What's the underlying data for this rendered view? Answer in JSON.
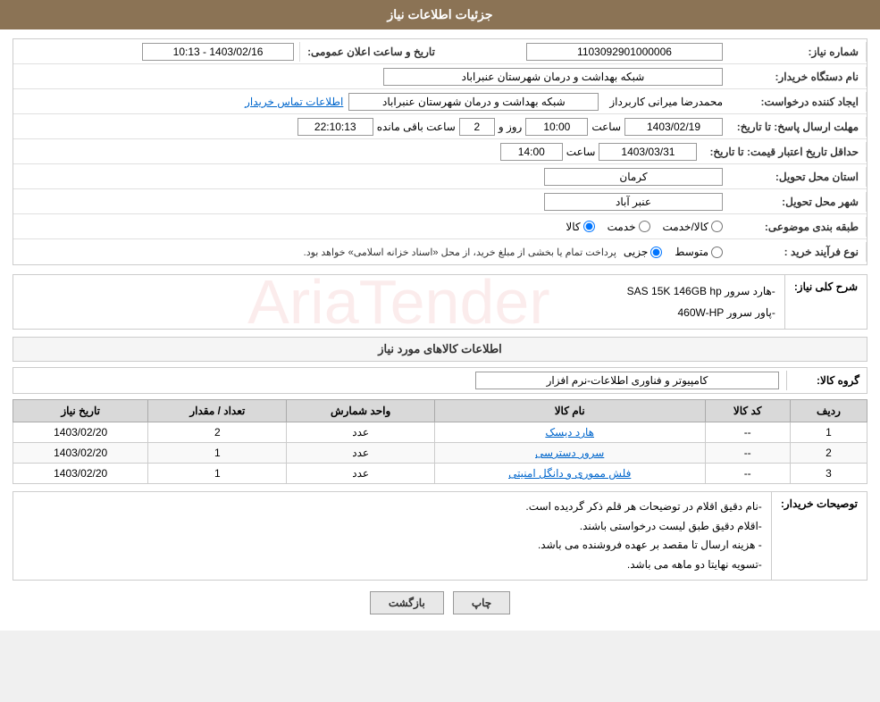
{
  "header": {
    "title": "جزئیات اطلاعات نیاز"
  },
  "fields": {
    "need_number_label": "شماره نیاز:",
    "need_number_value": "1103092901000006",
    "buyer_org_label": "نام دستگاه خریدار:",
    "buyer_org_value": "شبکه بهداشت و درمان شهرستان عنبراباد",
    "requester_label": "ایجاد کننده درخواست:",
    "requester_name": "محمدرضا میرانی کاربرداز",
    "requester_org": "شبکه بهداشت و درمان شهرستان عنبراباد",
    "contact_link": "اطلاعات تماس خریدار",
    "send_deadline_label": "مهلت ارسال پاسخ: تا تاریخ:",
    "send_date": "1403/02/19",
    "send_time_label": "ساعت",
    "send_time": "10:00",
    "send_days_label": "روز و",
    "send_days": "2",
    "send_remaining_label": "ساعت باقی مانده",
    "send_remaining": "22:10:13",
    "price_deadline_label": "حداقل تاریخ اعتبار قیمت: تا تاریخ:",
    "price_date": "1403/03/31",
    "price_time_label": "ساعت",
    "price_time": "14:00",
    "province_label": "استان محل تحویل:",
    "province_value": "کرمان",
    "city_label": "شهر محل تحویل:",
    "city_value": "عنبر آباد",
    "category_label": "طبقه بندی موضوعی:",
    "category_kala": "کالا",
    "category_khadamat": "خدمت",
    "category_kala_khadamat": "کالا/خدمت",
    "purchase_type_label": "نوع فرآیند خرید :",
    "purchase_jozei": "جزیی",
    "purchase_motavasset": "متوسط",
    "purchase_note": "پرداخت تمام یا بخشی از مبلغ خرید، از محل «اسناد خزانه اسلامی» خواهد بود.",
    "announce_label": "تاریخ و ساعت اعلان عمومی:",
    "announce_value": "1403/02/16 - 10:13",
    "description_label": "شرح کلی نیاز:",
    "description_line1": "-هارد سرور SAS 15K 146GB hp",
    "description_line2": "-پاور سرور 460W-HP",
    "needs_info_title": "اطلاعات کالاهای مورد نیاز",
    "group_label": "گروه کالا:",
    "group_value": "کامپیوتر و فناوری اطلاعات-نرم افزار",
    "table": {
      "col_radif": "ردیف",
      "col_kod": "کد کالا",
      "col_name": "نام کالا",
      "col_unit": "واحد شمارش",
      "col_count": "تعداد / مقدار",
      "col_date": "تاریخ نیاز",
      "rows": [
        {
          "radif": "1",
          "kod": "--",
          "name": "هارد دیسک",
          "unit": "عدد",
          "count": "2",
          "date": "1403/02/20"
        },
        {
          "radif": "2",
          "kod": "--",
          "name": "سرور دسترسی",
          "unit": "عدد",
          "count": "1",
          "date": "1403/02/20"
        },
        {
          "radif": "3",
          "kod": "--",
          "name": "فلش ممور‌ی و دانگل امنیتی",
          "unit": "عدد",
          "count": "1",
          "date": "1403/02/20"
        }
      ]
    },
    "notes_label": "توصیحات خریدار:",
    "notes_line1": "-نام دقیق اقلام در توضیحات هر قلم ذکر گردیده است.",
    "notes_line2": "-اقلام دقیق طبق لیست درخواستی باشند.",
    "notes_line3": "- هزینه ارسال تا مقصد بر عهده فروشنده می باشد.",
    "notes_line4": "-تسویه نهایتا دو ماهه می باشد.",
    "btn_print": "چاپ",
    "btn_back": "بازگشت"
  }
}
